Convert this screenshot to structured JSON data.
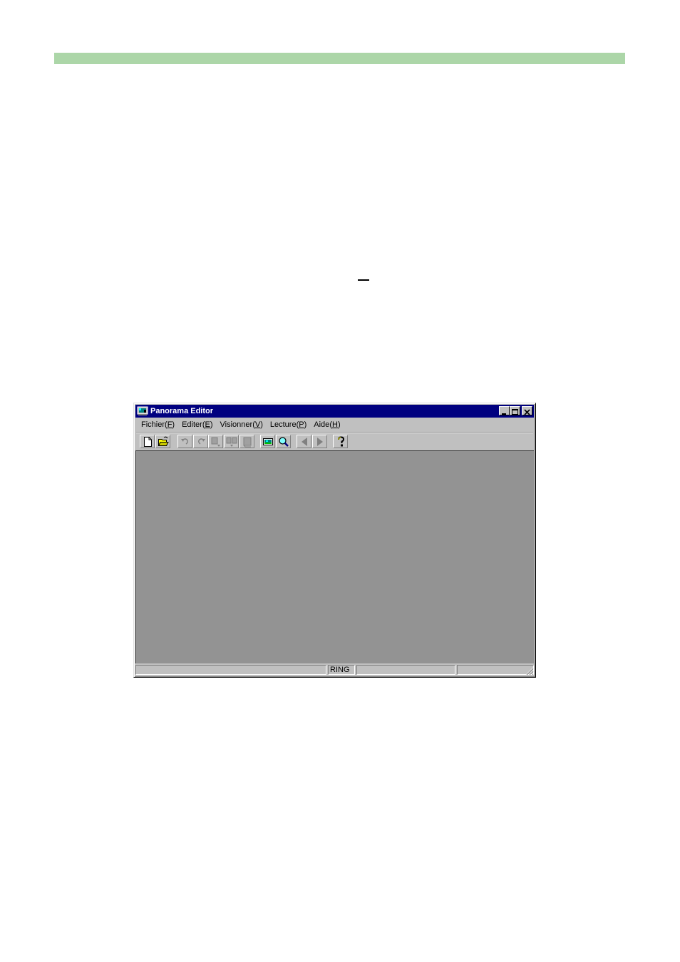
{
  "window": {
    "title": "Panorama Editor",
    "icon": "panorama-app-icon"
  },
  "menu": [
    {
      "name": "Fichier",
      "shortcut": "F"
    },
    {
      "name": "Editer",
      "shortcut": "E"
    },
    {
      "name": "Visionner",
      "shortcut": "V"
    },
    {
      "name": "Lecture",
      "shortcut": "P"
    },
    {
      "name": "Aide",
      "shortcut": "H"
    }
  ],
  "toolbar": [
    {
      "icon": "new-file-icon",
      "enabled": true
    },
    {
      "icon": "open-folder-icon",
      "enabled": true
    },
    {
      "icon": "undo-icon",
      "enabled": false
    },
    {
      "icon": "redo-icon",
      "enabled": false
    },
    {
      "icon": "image-insert-icon",
      "enabled": false
    },
    {
      "icon": "image-split-icon",
      "enabled": false
    },
    {
      "icon": "frame-icon",
      "enabled": false
    },
    {
      "icon": "panorama-view-icon",
      "enabled": true
    },
    {
      "icon": "zoom-icon",
      "enabled": true
    },
    {
      "icon": "previous-arrow-icon",
      "enabled": false
    },
    {
      "icon": "next-arrow-icon",
      "enabled": false
    },
    {
      "icon": "help-icon",
      "enabled": true
    }
  ],
  "status": {
    "pane1": "",
    "pane2": "RING",
    "pane3": "",
    "pane4": ""
  },
  "colors": {
    "titlebar": "#000080",
    "client_area": "#939393",
    "top_band": "#acd6a8"
  }
}
